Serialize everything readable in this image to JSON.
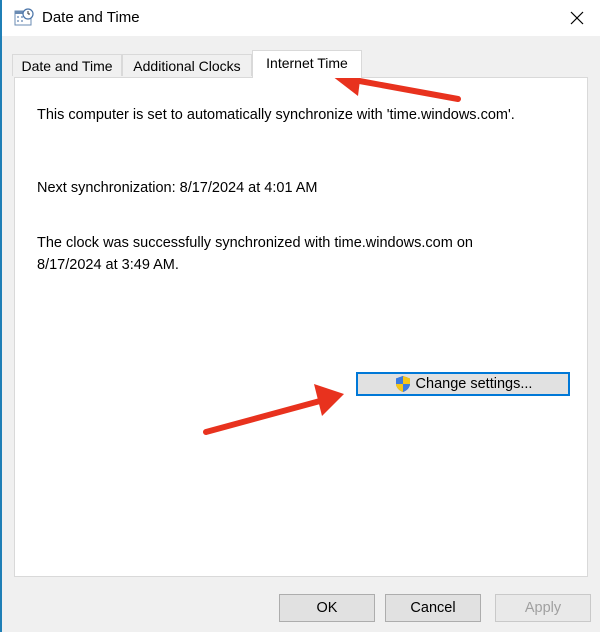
{
  "window": {
    "title": "Date and Time",
    "title_icon": "date-time-icon",
    "close_icon": "close-icon"
  },
  "tabs": [
    {
      "label": "Date and Time",
      "selected": false
    },
    {
      "label": "Additional Clocks",
      "selected": false
    },
    {
      "label": "Internet Time",
      "selected": true
    }
  ],
  "panel": {
    "sync_status": "This computer is set to automatically synchronize with 'time.windows.com'.",
    "next_sync": "Next synchronization: 8/17/2024 at 4:01 AM",
    "last_sync_line1": "The clock was successfully synchronized with time.windows.com on",
    "last_sync_line2": "8/17/2024 at 3:49 AM.",
    "change_settings_label": "Change settings...",
    "change_settings_icon": "uac-shield-icon"
  },
  "buttons": {
    "ok": "OK",
    "cancel": "Cancel",
    "apply": "Apply"
  },
  "colors": {
    "accent": "#0078d7",
    "annotation_arrow": "#e8321e"
  }
}
